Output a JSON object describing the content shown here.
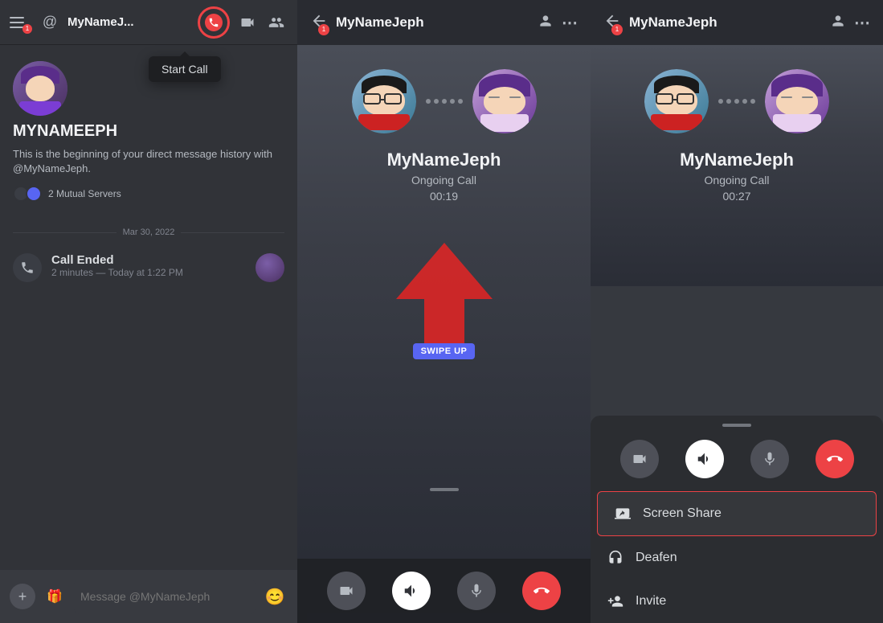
{
  "panel1": {
    "username": "MyNameJ...",
    "start_call_label": "Start Call",
    "profile_name": "MYNAMEEPH",
    "profile_desc": "This is the beginning of your direct message history with @MyNameJeph.",
    "mutual_servers": "2 Mutual Servers",
    "date_divider": "Mar 30, 2022",
    "call_ended_title": "Call Ended",
    "call_ended_subtitle": "2 minutes — Today at 1:22 PM",
    "message_placeholder": "Message @MyNameJeph"
  },
  "panel2": {
    "username": "MyNameJeph",
    "call_name": "MyNameJeph",
    "call_status": "Ongoing Call",
    "call_timer": "00:19",
    "swipe_up_label": "SWIPE UP"
  },
  "panel3": {
    "username": "MyNameJeph",
    "call_name": "MyNameJeph",
    "call_status": "Ongoing Call",
    "call_timer": "00:27",
    "menu_items": [
      {
        "label": "Screen Share",
        "icon": "screen-share"
      },
      {
        "label": "Deafen",
        "icon": "headphones"
      },
      {
        "label": "Invite",
        "icon": "invite"
      }
    ]
  },
  "icons": {
    "phone": "📞",
    "video": "📹",
    "friends": "👥",
    "mute": "🔇",
    "unmute": "🔊",
    "mic": "🎙",
    "end_call": "✕",
    "more": "⋯",
    "plus": "+",
    "gift": "🎁",
    "emoji": "😊",
    "person": "👤",
    "screen": "🖥",
    "headphones": "🎧",
    "invite": "👤"
  }
}
